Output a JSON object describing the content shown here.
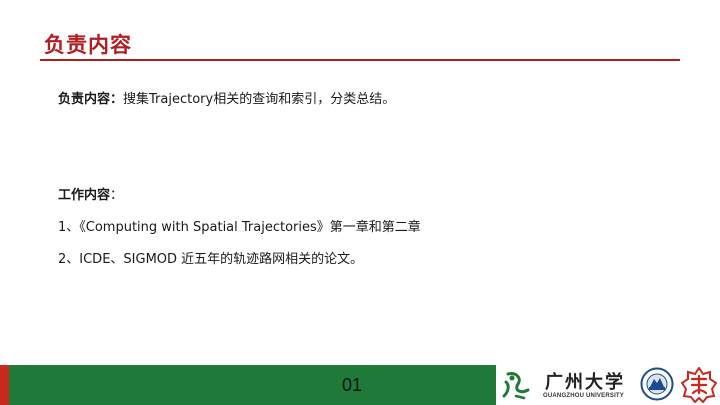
{
  "slide": {
    "title": "负责内容",
    "responsibility": {
      "label": "负责内容：",
      "text": "搜集Trajectory相关的查询和索引，分类总结。"
    },
    "work": {
      "label": "工作内容",
      "colon": "：",
      "items": [
        "1、《Computing with Spatial Trajectories》第一章和第二章",
        "2、ICDE、SIGMOD  近五年的轨迹路网相关的论文。"
      ]
    },
    "page_number": "01"
  },
  "footer": {
    "university_name_cn": "广州大学",
    "university_name_en": "GUANGZHOU UNIVERSITY",
    "colors": {
      "bar": "#1f7a3a",
      "accent": "#c8291f",
      "title": "#b01e23"
    }
  }
}
